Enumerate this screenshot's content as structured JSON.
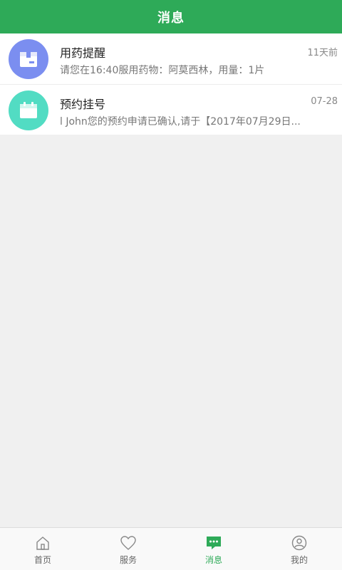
{
  "header": {
    "title": "消息"
  },
  "messages": [
    {
      "title": "用药提醒",
      "time": "11天前",
      "preview": "请您在16:40服用药物：阿莫西林，用量：1片",
      "icon": "box-icon",
      "icon_color": "#7b8ef0"
    },
    {
      "title": "预约挂号",
      "time": "07-28",
      "preview": "l John您的预约申请已确认,请于【2017年07月29日...",
      "icon": "calendar-icon",
      "icon_color": "#52dcc3"
    }
  ],
  "tabbar": {
    "items": [
      {
        "label": "首页",
        "icon": "home-icon"
      },
      {
        "label": "服务",
        "icon": "heart-icon"
      },
      {
        "label": "消息",
        "icon": "chat-bubble-icon",
        "active": true
      },
      {
        "label": "我的",
        "icon": "profile-icon"
      }
    ],
    "active_color": "#2eaa58"
  },
  "colors": {
    "brand": "#2eaa58",
    "background": "#f0f0f0"
  }
}
